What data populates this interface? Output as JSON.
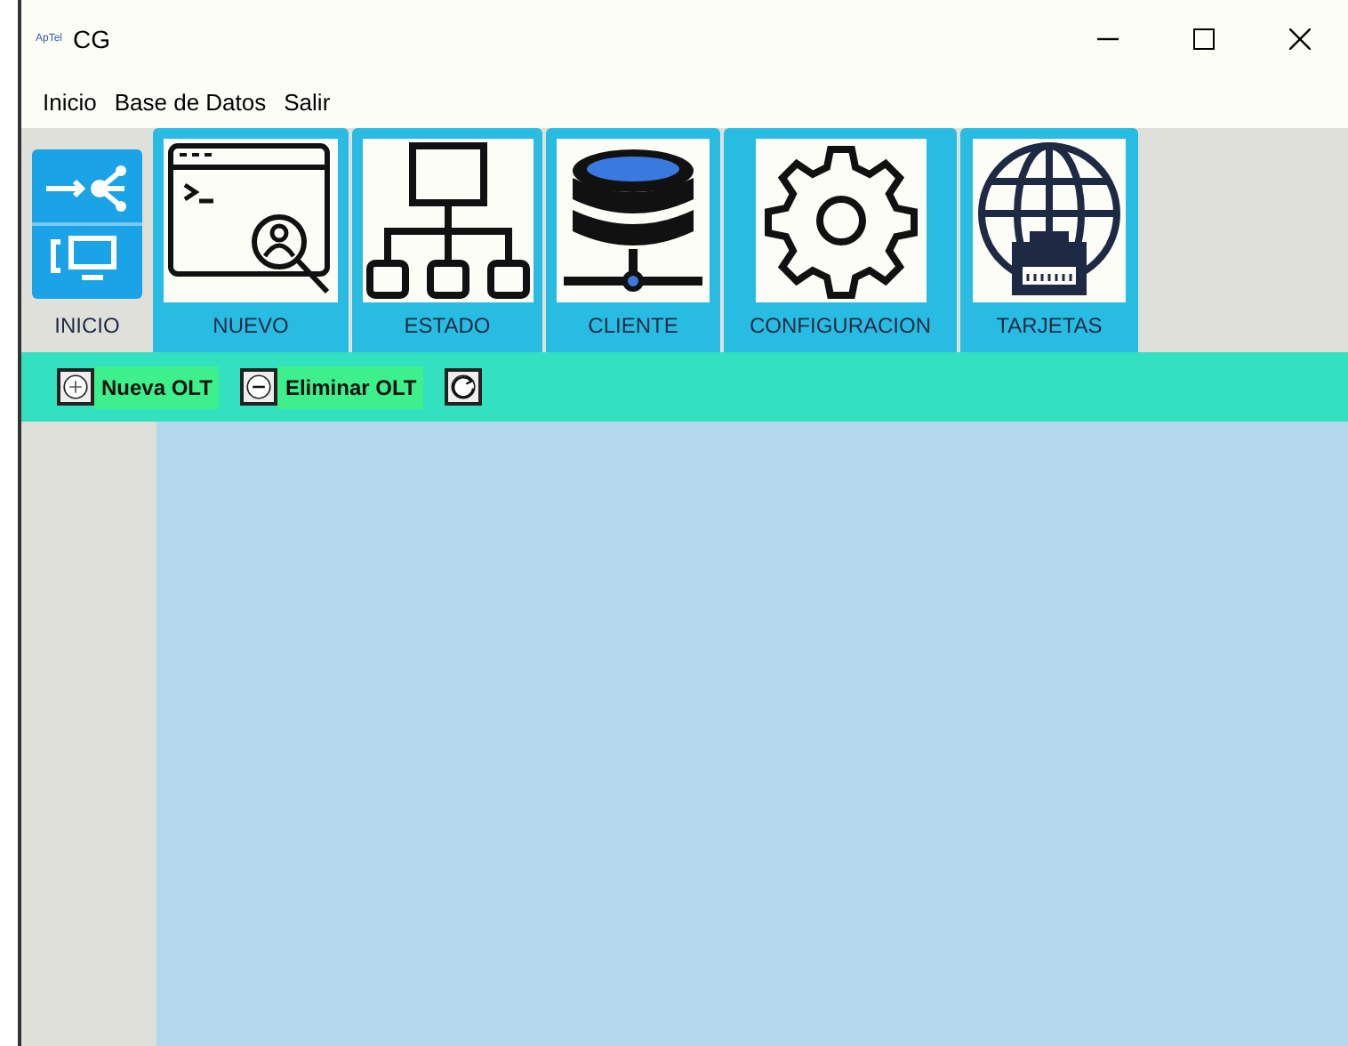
{
  "window": {
    "logo": "ApTel",
    "title": "CG"
  },
  "menu": [
    "Inicio",
    "Base de Datos",
    "Salir"
  ],
  "tabs": [
    {
      "label": "INICIO",
      "selected": true
    },
    {
      "label": "NUEVO",
      "selected": false
    },
    {
      "label": "ESTADO",
      "selected": false
    },
    {
      "label": "CLIENTE",
      "selected": false
    },
    {
      "label": "CONFIGURACION",
      "selected": false
    },
    {
      "label": "TARJETAS",
      "selected": false
    }
  ],
  "toolbar": [
    {
      "kind": "add",
      "label": "Nueva OLT"
    },
    {
      "kind": "remove",
      "label": "Eliminar OLT"
    },
    {
      "kind": "refresh"
    }
  ]
}
